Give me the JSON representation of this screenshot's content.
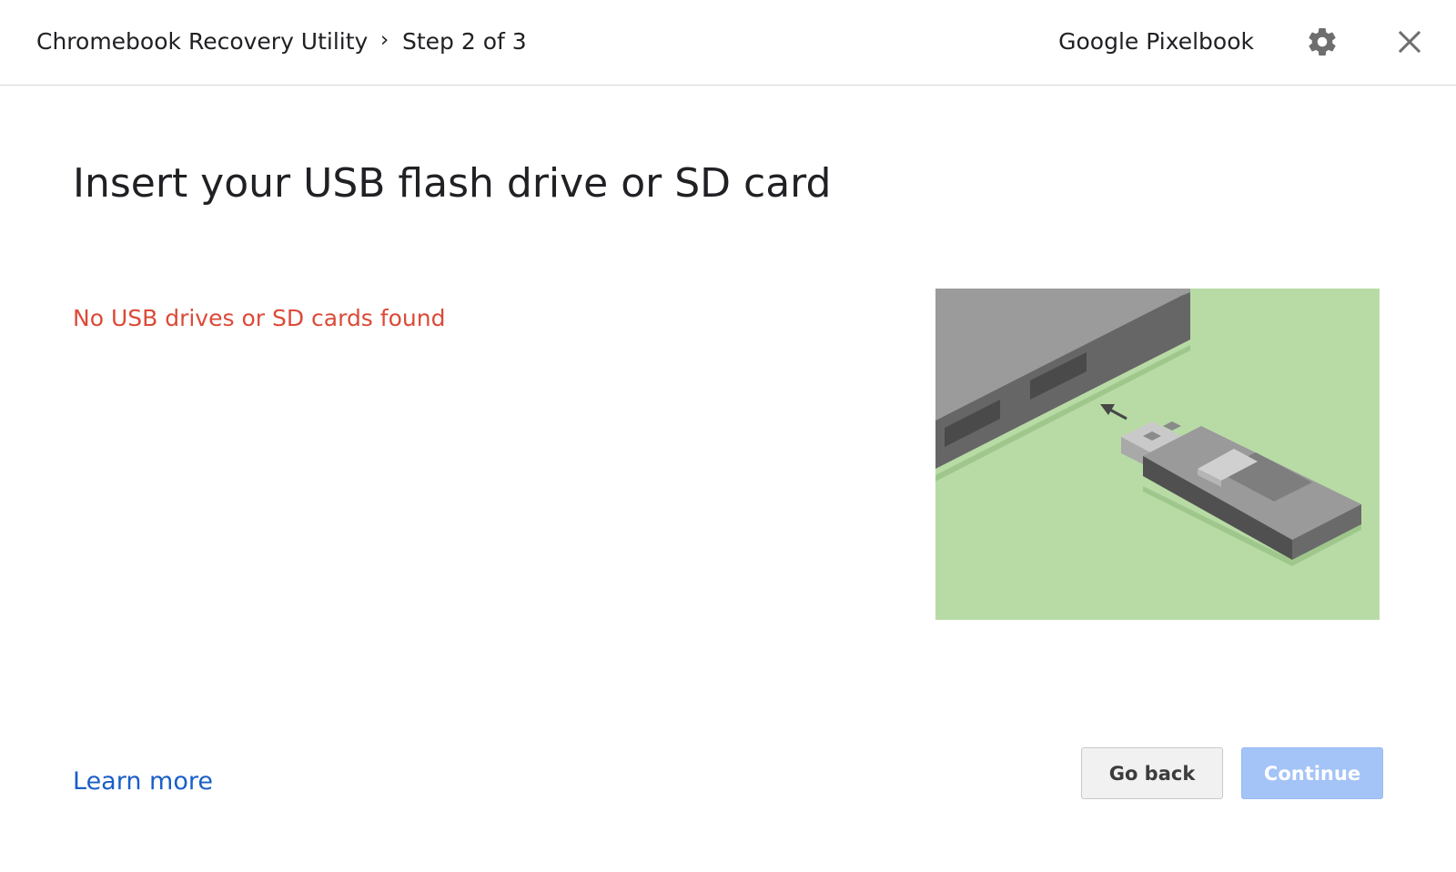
{
  "header": {
    "app_title": "Chromebook Recovery Utility",
    "breadcrumb_separator": "›",
    "step_label": "Step 2 of 3",
    "device_name": "Google Pixelbook",
    "settings_icon": "gear-icon",
    "close_icon": "close-icon"
  },
  "main": {
    "heading": "Insert your USB flash drive or SD card",
    "status_message": "No USB drives or SD cards found",
    "illustration": "laptop-usb-insert-illustration"
  },
  "footer": {
    "learn_more_label": "Learn more",
    "go_back_label": "Go back",
    "continue_label": "Continue"
  },
  "colors": {
    "error_text": "#dc4a38",
    "link": "#1a5ec8",
    "continue_disabled_bg": "#a4c3f7",
    "illustration_bg": "#b8dba6"
  }
}
